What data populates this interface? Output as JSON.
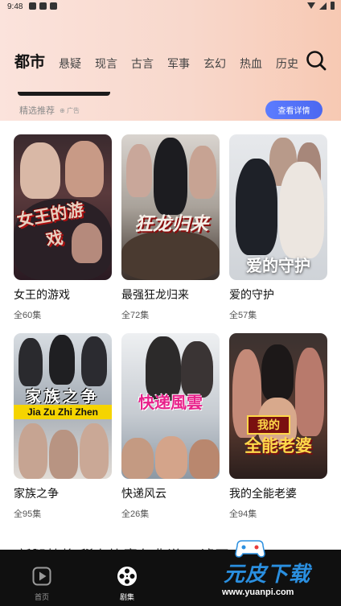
{
  "status_bar": {
    "time": "9:48"
  },
  "tabs": [
    {
      "label": "都市",
      "active": true
    },
    {
      "label": "悬疑"
    },
    {
      "label": "现言"
    },
    {
      "label": "古言"
    },
    {
      "label": "军事"
    },
    {
      "label": "玄幻"
    },
    {
      "label": "热血"
    },
    {
      "label": "历史"
    }
  ],
  "section": {
    "title": "精选推荐",
    "ad_label": "广告",
    "detail_button": "查看详情"
  },
  "dramas": [
    {
      "title": "女王的游戏",
      "episodes": "全60集",
      "poster_text": "女王的游戏"
    },
    {
      "title": "最强狂龙归来",
      "episodes": "全72集",
      "poster_text": "狂龙归来"
    },
    {
      "title": "爱的守护",
      "episodes": "全57集",
      "poster_text": "爱的守护"
    },
    {
      "title": "家族之争",
      "episodes": "全95集",
      "poster_text": "家族之争",
      "poster_pinyin": "Jia Zu Zhi Zhen"
    },
    {
      "title": "快递风云",
      "episodes": "全26集",
      "poster_text": "快递風雲"
    },
    {
      "title": "我的全能老婆",
      "episodes": "全94集",
      "poster_text_top": "我的",
      "poster_text": "全能老婆"
    }
  ],
  "ticker": "新腿杜将   稀有比赛色典说！  滤页",
  "bottom_nav": [
    {
      "label": "首页",
      "icon": "play-icon"
    },
    {
      "label": "剧集",
      "icon": "film-reel-icon",
      "active": true
    }
  ],
  "watermark": {
    "text": "元皮下载",
    "url": "www.yuanpi.com"
  },
  "colors": {
    "accent": "#4c68f0",
    "nav_bg": "#101010",
    "watermark": "#2a8fe0"
  }
}
